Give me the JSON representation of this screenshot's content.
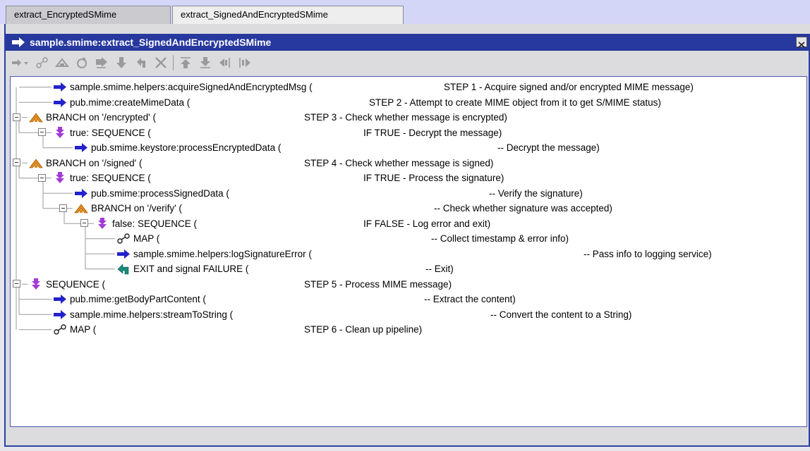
{
  "tabs": [
    {
      "label": "extract_EncryptedSMime",
      "active": false
    },
    {
      "label": "extract_SignedAndEncryptedSMime",
      "active": true
    }
  ],
  "panel": {
    "title": "sample.smime:extract_SignedAndEncryptedSMime"
  },
  "toolbar": {
    "icons": [
      "arrow-dropdown-icon",
      "map-icon",
      "branch-icon",
      "repeat-icon",
      "sequence-icon",
      "down-arrow-icon",
      "exit-icon",
      "delete-icon",
      "move-up-icon",
      "move-down-icon",
      "indent-left-icon",
      "indent-right-icon"
    ]
  },
  "tree": {
    "rows": [
      {
        "type": "invoke",
        "label": "sample.smime.helpers:acquireSignedAndEncryptedMsg (",
        "comment": "STEP 1 - Acquire signed and/or encrypted MIME message)"
      },
      {
        "type": "invoke",
        "label": "pub.mime:createMimeData (",
        "comment": "STEP 2 - Attempt to create MIME object from it to get S/MIME status)"
      },
      {
        "type": "branch",
        "label": "BRANCH on '/encrypted' (",
        "comment": "STEP 3 - Check whether message is encrypted)"
      },
      {
        "type": "sequence",
        "label": "true: SEQUENCE (",
        "comment": "IF TRUE - Decrypt the message)"
      },
      {
        "type": "invoke",
        "label": "pub.smime.keystore:processEncryptedData (",
        "comment": "-- Decrypt the message)"
      },
      {
        "type": "branch",
        "label": "BRANCH on '/signed' (",
        "comment": "STEP 4 - Check whether message is signed)"
      },
      {
        "type": "sequence",
        "label": "true: SEQUENCE (",
        "comment": "IF TRUE - Process the signature)"
      },
      {
        "type": "invoke",
        "label": "pub.smime:processSignedData (",
        "comment": "-- Verify the signature)"
      },
      {
        "type": "branch",
        "label": "BRANCH on '/verify' (",
        "comment": "-- Check whether signature was accepted)"
      },
      {
        "type": "sequence",
        "label": "false: SEQUENCE (",
        "comment": "IF FALSE - Log error and exit)"
      },
      {
        "type": "map",
        "label": "MAP (",
        "comment": "-- Collect timestamp & error info)"
      },
      {
        "type": "invoke",
        "label": "sample.smime.helpers:logSignatureError (",
        "comment": "-- Pass info to logging service)"
      },
      {
        "type": "exit",
        "label": "EXIT and signal FAILURE (",
        "comment": "-- Exit)"
      },
      {
        "type": "sequence",
        "label": "SEQUENCE (",
        "comment": "STEP 5 - Process MIME message)"
      },
      {
        "type": "invoke",
        "label": "pub.mime:getBodyPartContent (",
        "comment": "-- Extract the content)"
      },
      {
        "type": "invoke",
        "label": "sample.mime.helpers:streamToString (",
        "comment": "-- Convert the content to a String)"
      },
      {
        "type": "map",
        "label": "MAP (",
        "comment": "STEP 6 - Clean up pipeline)"
      }
    ]
  },
  "colors": {
    "titlebar": "#27389e",
    "invoke_arrow": "#2222cc",
    "sequence": "#a23bd6",
    "branch": "#e08a1c",
    "exit": "#1a8a7a"
  }
}
